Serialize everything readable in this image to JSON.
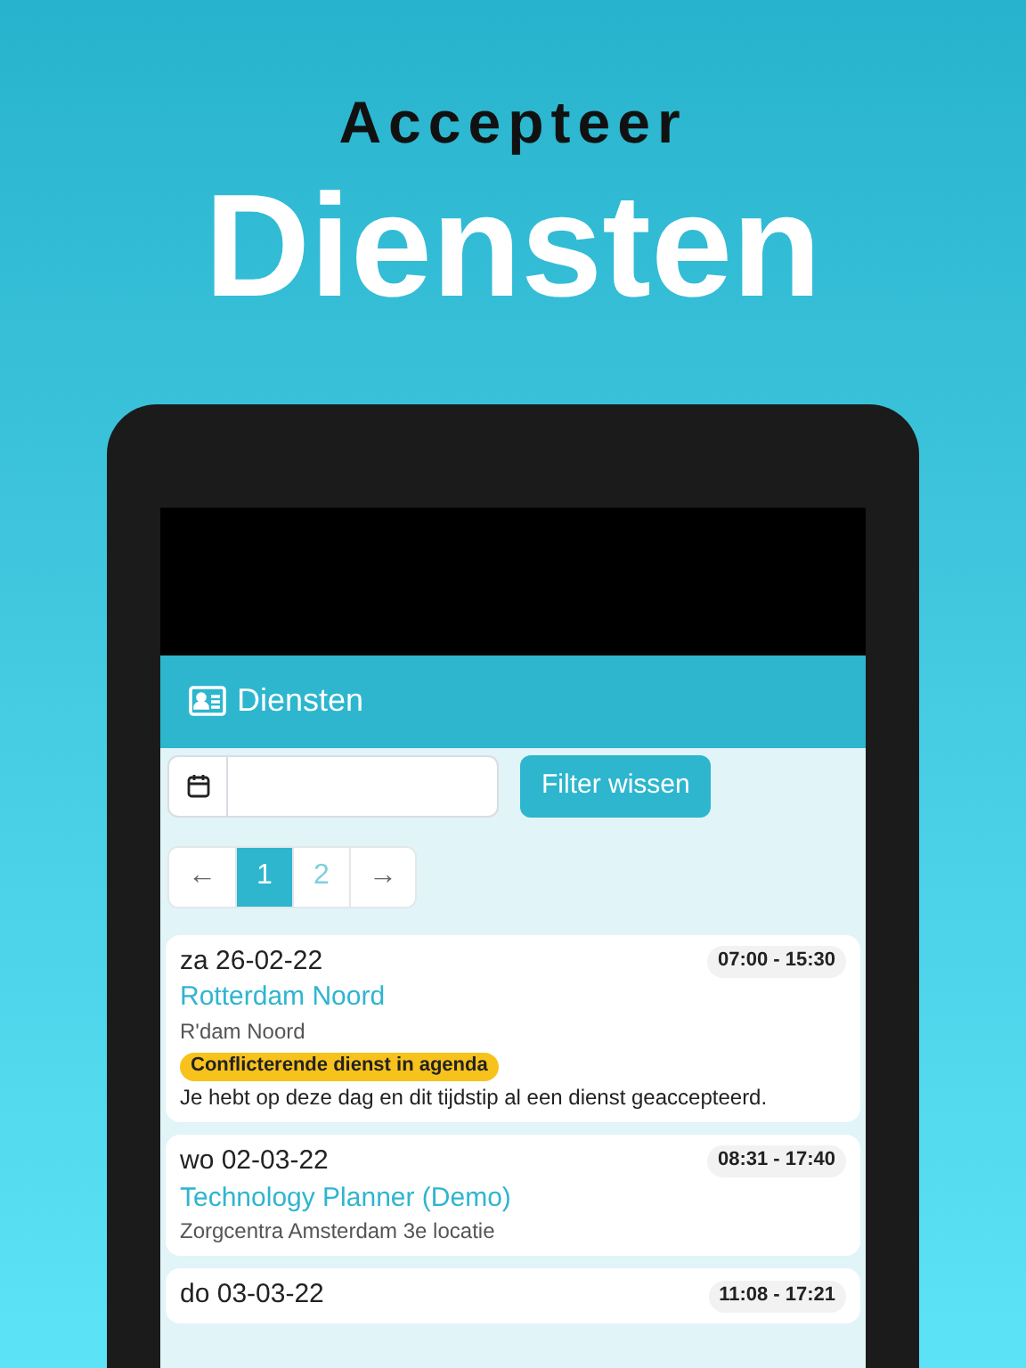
{
  "headline": {
    "kicker": "Accepteer",
    "title": "Diensten"
  },
  "app_bar": {
    "title": "Diensten"
  },
  "filter": {
    "clear_button": "Filter wissen"
  },
  "pagination": [
    {
      "label": "←",
      "kind": "arrow",
      "selected": false
    },
    {
      "label": "1",
      "kind": "page",
      "selected": true
    },
    {
      "label": "2",
      "kind": "page",
      "selected": false
    },
    {
      "label": "→",
      "kind": "arrow",
      "selected": false
    }
  ],
  "shifts": [
    {
      "date": "za 26-02-22",
      "time": "07:00 - 15:30",
      "name": "Rotterdam Noord",
      "location": "R'dam Noord",
      "badge": "Conflicterende dienst in agenda",
      "note": "Je hebt op deze dag en dit tijdstip al een dienst geaccepteerd."
    },
    {
      "date": "wo 02-03-22",
      "time": "08:31 - 17:40",
      "name": "Technology Planner (Demo)",
      "location": "Zorgcentra Amsterdam 3e locatie"
    },
    {
      "date": "do 03-03-22",
      "time": "11:08 - 17:21"
    }
  ]
}
